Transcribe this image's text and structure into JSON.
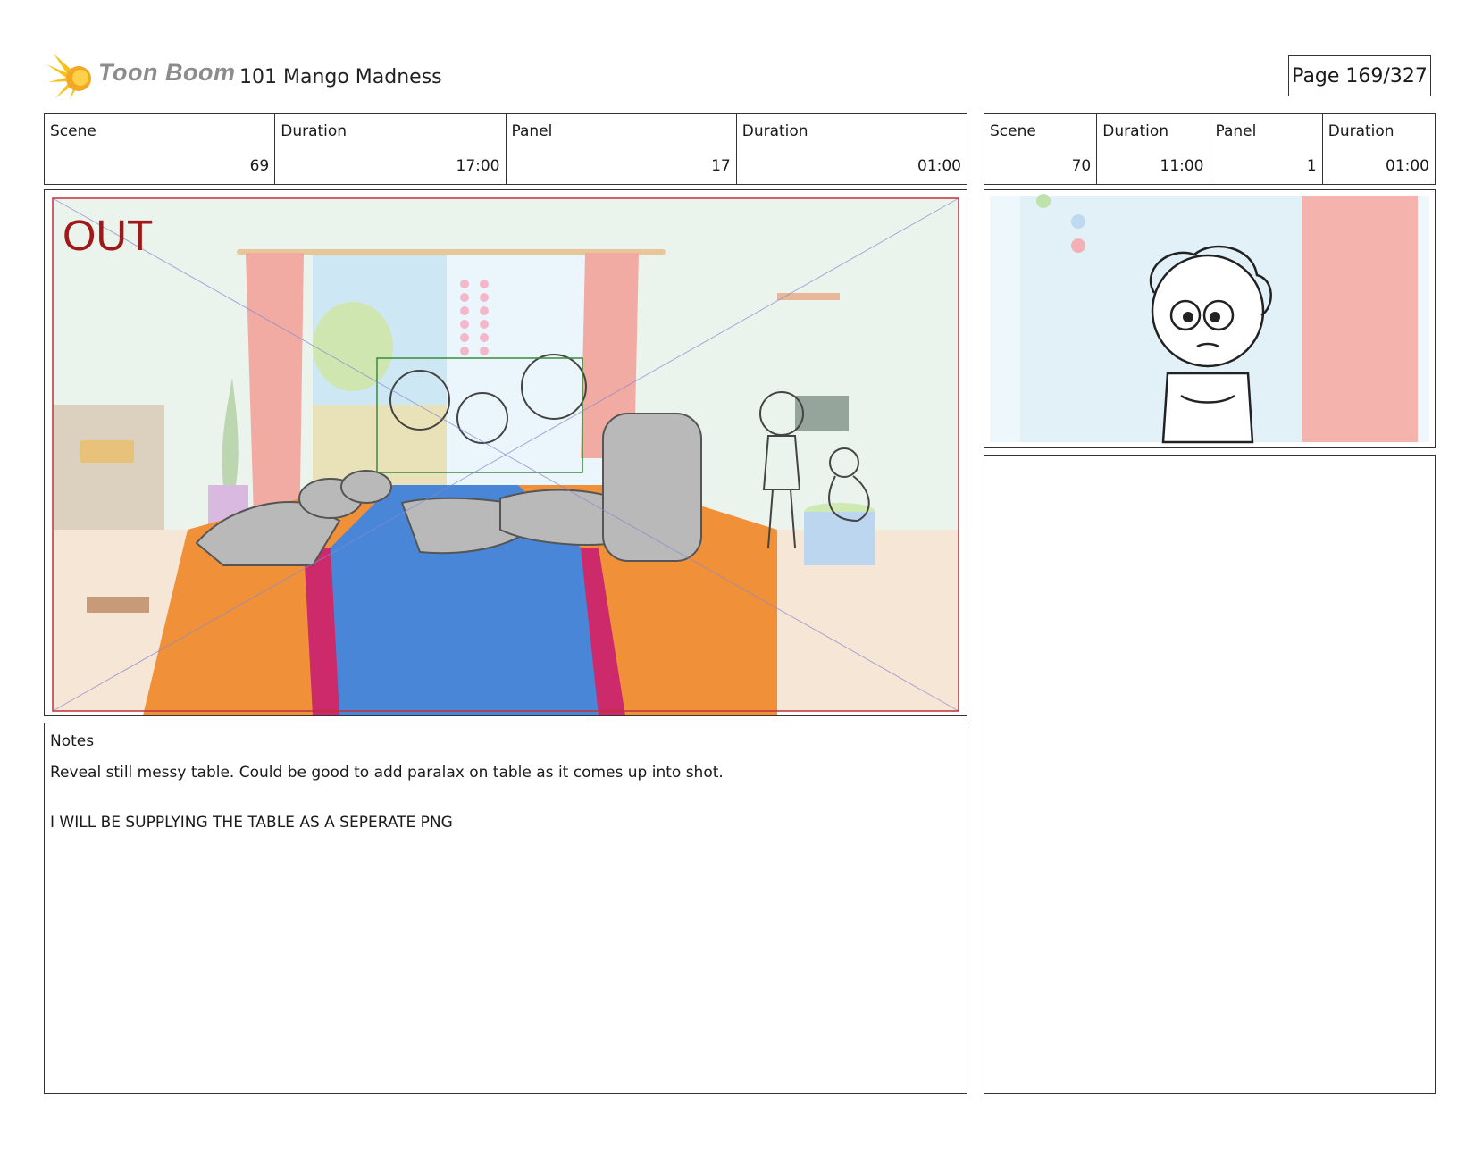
{
  "header": {
    "logo_text": "Toon Boom",
    "project_title": "101 Mango Madness",
    "page": "Page 169/327"
  },
  "left_panel": {
    "info": [
      {
        "label": "Scene",
        "value": "69"
      },
      {
        "label": "Duration",
        "value": "17:00"
      },
      {
        "label": "Panel",
        "value": "17"
      },
      {
        "label": "Duration",
        "value": "01:00"
      }
    ],
    "frame_label": "OUT",
    "notes_label": "Notes",
    "notes_lines": [
      "Reveal still messy table. Could be good to add paralax on table as it comes up into shot.",
      "I WILL BE SUPPLYING THE TABLE AS A SEPERATE PNG"
    ]
  },
  "right_panel": {
    "info": [
      {
        "label": "Scene",
        "value": "70"
      },
      {
        "label": "Duration",
        "value": "11:00"
      },
      {
        "label": "Panel",
        "value": "1"
      },
      {
        "label": "Duration",
        "value": "01:00"
      }
    ]
  },
  "colors": {
    "frame_label": "#a01818",
    "table_orange": "#f0913a",
    "table_blue": "#4a86d8",
    "table_pink": "#cc2a6a",
    "curtain": "#f2a9a0",
    "wall": "#e8f3ea",
    "sketch_gray": "#b9b9b9"
  }
}
